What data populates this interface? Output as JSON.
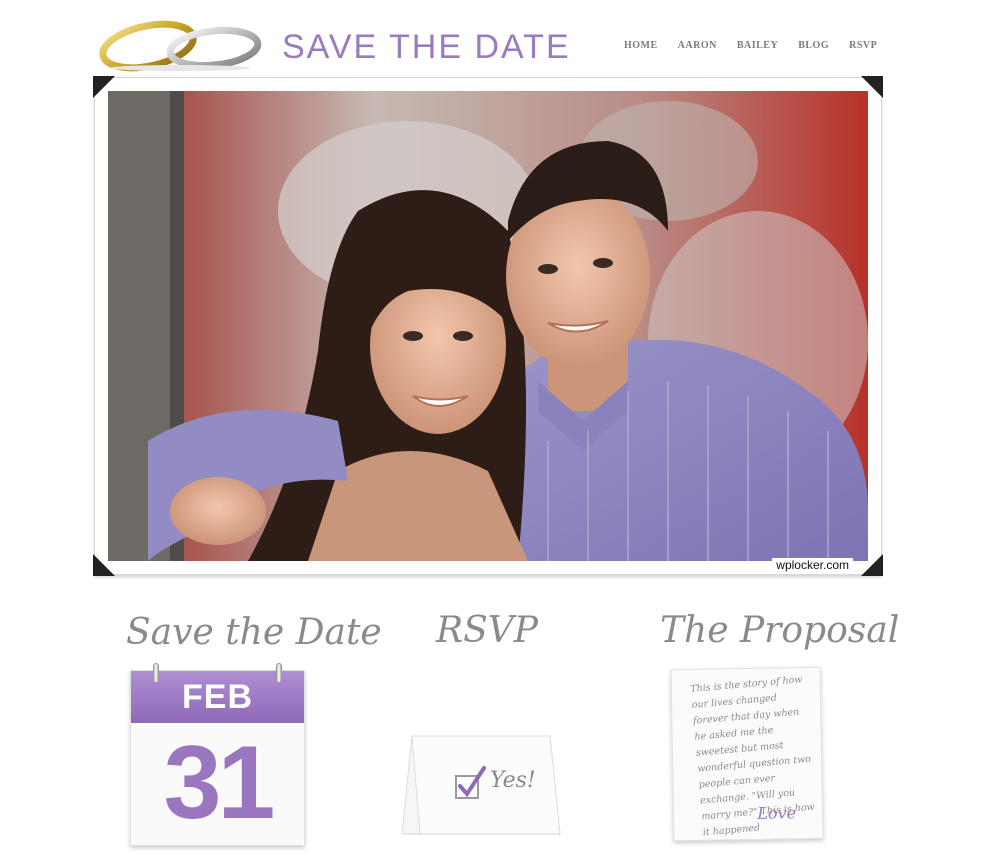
{
  "header": {
    "title": "SAVE THE DATE",
    "logo_icon": "wedding-rings-icon"
  },
  "nav": {
    "items": [
      {
        "label": "HOME"
      },
      {
        "label": "AARON"
      },
      {
        "label": "BAILEY"
      },
      {
        "label": "BLOG"
      },
      {
        "label": "RSVP"
      }
    ]
  },
  "hero": {
    "watermark": "wplocker.com"
  },
  "sections": {
    "save_the_date": {
      "title": "Save the Date",
      "month": "FEB",
      "day": "31"
    },
    "rsvp": {
      "title": "RSVP",
      "answer": "Yes!"
    },
    "proposal": {
      "title": "The Proposal",
      "body": "This is the story of how our lives changed forever that day when he asked me the sweetest but most wonderful question two people can ever exchange. \"Will you marry me?\" This is how it happened",
      "signoff": "Love"
    }
  },
  "colors": {
    "accent": "#9a75c0",
    "nav_text": "#7a7a7a",
    "script_text": "#8a8a8a"
  }
}
